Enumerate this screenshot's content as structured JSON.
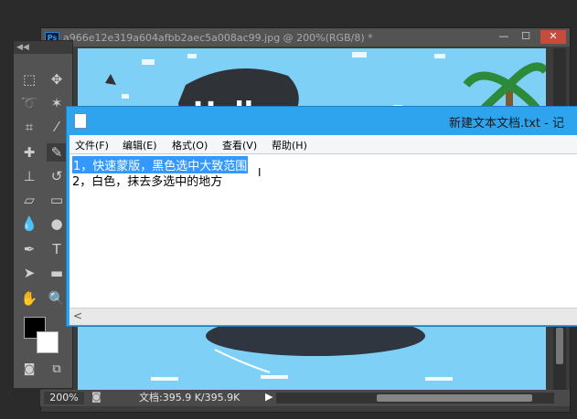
{
  "photoshop": {
    "badge": "Ps",
    "doc_title": "a966e12e319a604afbb2aec5a008ac99.jpg @ 200%(RGB/8) *",
    "window_buttons": {
      "minimize": "—",
      "maximize": "☐",
      "close": "✕"
    },
    "canvas": {
      "bubble_text": "Hello",
      "sky_color": "#7fd0f6",
      "ground_color": "#2f3640"
    },
    "tools": {
      "panel_handle": "◀◀",
      "items": [
        "marquee-icon",
        "move-icon",
        "lasso-icon",
        "magic-wand-icon",
        "crop-icon",
        "eyedropper-icon",
        "healing-icon",
        "brush-icon",
        "stamp-icon",
        "history-brush-icon",
        "eraser-icon",
        "gradient-icon",
        "blur-icon",
        "dodge-icon",
        "pen-icon",
        "type-icon",
        "path-select-icon",
        "shape-icon",
        "hand-icon",
        "zoom-icon"
      ]
    },
    "status": {
      "zoom": "200%",
      "doc_info": "文档:395.9 K/395.9K"
    }
  },
  "notepad": {
    "title": "新建文本文档.txt - 记",
    "menus": [
      "文件(F)",
      "编辑(E)",
      "格式(O)",
      "查看(V)",
      "帮助(H)"
    ],
    "lines": [
      "1，快速蒙版，黑色选中大致范围",
      "2，白色，抹去多选中的地方"
    ],
    "scroll_left": "<"
  },
  "colors": {
    "selection": "#3399ff",
    "notepad_frame": "#2ea4ee",
    "ps_close": "#c94a3b"
  }
}
